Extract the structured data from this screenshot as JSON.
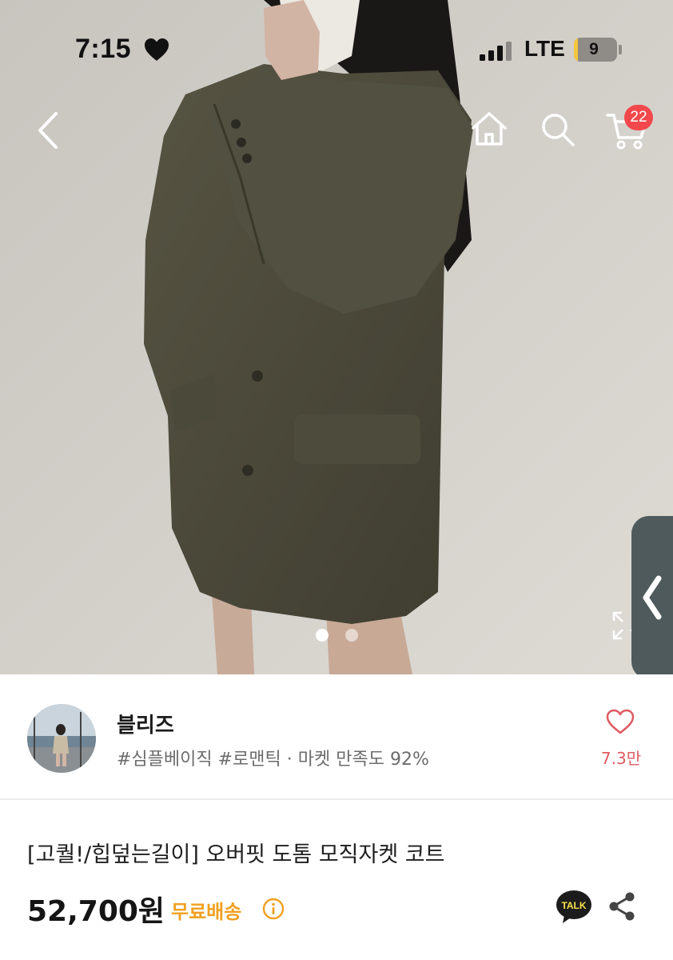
{
  "status_bar": {
    "time": "7:15",
    "network": "LTE",
    "battery": "9",
    "battery_fraction": 0.09,
    "icons": [
      "heart-icon",
      "signal-bars-icon",
      "battery-icon"
    ]
  },
  "header": {
    "icons": [
      "back-chevron-icon",
      "home-icon",
      "search-icon",
      "cart-icon"
    ],
    "cart_count": "22"
  },
  "carousel": {
    "current_page": 1,
    "total_pages": 2,
    "icons": [
      "expand-icon",
      "side-panel-chevron-icon"
    ]
  },
  "shop": {
    "name": "블리즈",
    "tags": "#심플베이직 #로맨틱 · 마켓 만족도 92%",
    "likes": "7.3만",
    "icons": [
      "shop-avatar-image",
      "heart-outline-icon"
    ]
  },
  "product": {
    "title": "[고퀄!/힙덮는길이] 오버핏 도톰 모직자켓 코트",
    "price": "52,700원",
    "shipping": "무료배송",
    "icons": [
      "info-icon",
      "kakao-talk-icon",
      "share-icon"
    ]
  },
  "colors": {
    "badge": "#f2484c",
    "like": "#e05a62",
    "free_shipping": "#f0a020",
    "jacket": "#4a4838"
  }
}
